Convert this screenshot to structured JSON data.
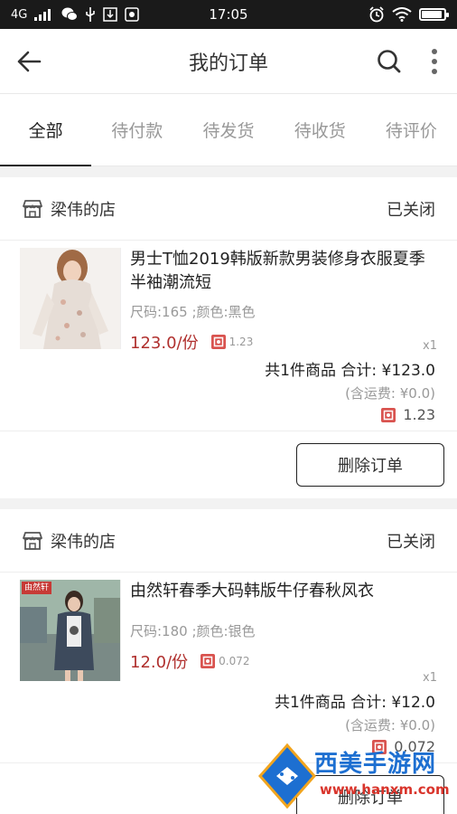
{
  "status_bar": {
    "network": "4G",
    "time": "17:05",
    "battery_level": 0.92
  },
  "header": {
    "title": "我的订单"
  },
  "tabs": [
    {
      "label": "全部",
      "active": true
    },
    {
      "label": "待付款",
      "active": false
    },
    {
      "label": "待发货",
      "active": false
    },
    {
      "label": "待收货",
      "active": false
    },
    {
      "label": "待评价",
      "active": false
    }
  ],
  "orders": [
    {
      "shop_name": "梁伟的店",
      "status": "已关闭",
      "item": {
        "title": "男士T恤2019韩版新款男装修身衣服夏季半袖潮流短",
        "spec": "尺码:165 ;颜色:黑色",
        "price": "123.0/份",
        "points": "1.23",
        "qty": "x1"
      },
      "summary": "共1件商品  合计: ¥123.0",
      "shipping": "(含运费: ¥0.0)",
      "points_total": "1.23",
      "action": "删除订单"
    },
    {
      "shop_name": "梁伟的店",
      "status": "已关闭",
      "item": {
        "title": "由然轩春季大码韩版牛仔春秋风衣",
        "spec": "尺码:180 ;颜色:银色",
        "price": "12.0/份",
        "points": "0.072",
        "qty": "x1",
        "badge": "由然轩"
      },
      "summary": "共1件商品  合计: ¥12.0",
      "shipping": "(含运费: ¥0.0)",
      "points_total": "0.072",
      "action": "删除订单"
    }
  ],
  "watermark": {
    "name": "西美手游网",
    "url": "www.hanxm.com"
  },
  "colors": {
    "price": "#b0302e",
    "points_icon": "#d9534f",
    "status_bar": "#1a1a1a"
  }
}
